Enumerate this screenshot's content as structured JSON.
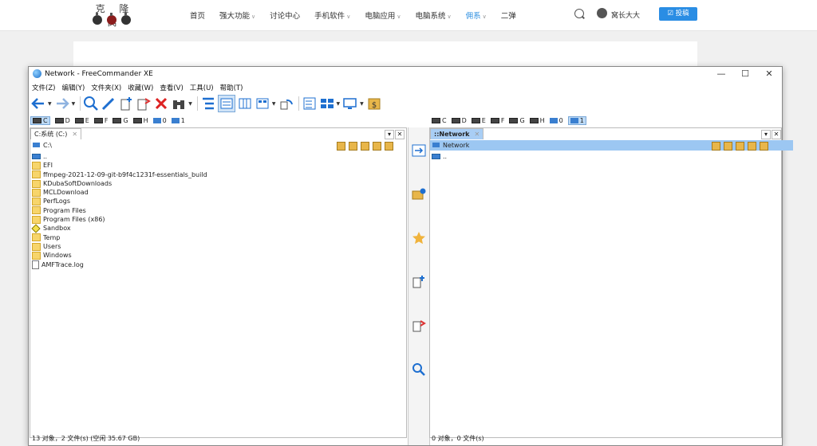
{
  "site": {
    "logo_text": "克 隆 窝",
    "nav": [
      {
        "label": "首页",
        "dropdown": false,
        "active": false
      },
      {
        "label": "强大功能",
        "dropdown": true,
        "active": false
      },
      {
        "label": "讨论中心",
        "dropdown": false,
        "active": false
      },
      {
        "label": "手机软件",
        "dropdown": true,
        "active": false
      },
      {
        "label": "电脑应用",
        "dropdown": true,
        "active": false
      },
      {
        "label": "电脑系统",
        "dropdown": true,
        "active": false
      },
      {
        "label": "佣系",
        "dropdown": true,
        "active": true
      },
      {
        "label": "二弹",
        "dropdown": false,
        "active": false
      }
    ],
    "user_name": "窝长大大",
    "submit_label": "☑ 投稿",
    "accent": "#2a8de4"
  },
  "window": {
    "title": "Network - FreeCommander XE",
    "minimize": "—",
    "maximize": "☐",
    "close": "✕"
  },
  "menu": [
    "文件(Z)",
    "编辑(Y)",
    "文件夹(X)",
    "收藏(W)",
    "查看(V)",
    "工具(U)",
    "帮助(T)"
  ],
  "drives_left": [
    {
      "label": "C",
      "selected": true
    },
    {
      "label": "D"
    },
    {
      "label": "E"
    },
    {
      "label": "F"
    },
    {
      "label": "G"
    },
    {
      "label": "H"
    }
  ],
  "drives_right": [
    {
      "label": "C"
    },
    {
      "label": "D"
    },
    {
      "label": "E"
    },
    {
      "label": "F"
    },
    {
      "label": "G"
    },
    {
      "label": "H"
    }
  ],
  "drive_extra": {
    "zero": "0",
    "one": "1"
  },
  "left_pane": {
    "tab_label": "C:系统 (C:)",
    "path": "C:\\",
    "files": [
      {
        "name": "..",
        "type": "up"
      },
      {
        "name": "EFI",
        "type": "folder"
      },
      {
        "name": "ffmpeg-2021-12-09-git-b9f4c1231f-essentials_build",
        "type": "folder"
      },
      {
        "name": "KDubaSoftDownloads",
        "type": "folder"
      },
      {
        "name": "MCLDownload",
        "type": "folder"
      },
      {
        "name": "PerfLogs",
        "type": "folder"
      },
      {
        "name": "Program Files",
        "type": "folder"
      },
      {
        "name": "Program Files (x86)",
        "type": "folder"
      },
      {
        "name": "Sandbox",
        "type": "sandbox"
      },
      {
        "name": "Temp",
        "type": "folder"
      },
      {
        "name": "Users",
        "type": "folder"
      },
      {
        "name": "Windows",
        "type": "folder"
      },
      {
        "name": "AMFTrace.log",
        "type": "file"
      }
    ],
    "status": "13 对象，2 文件(s)  (空闲 35.67 GB)"
  },
  "right_pane": {
    "tab_label": "::Network",
    "path": "Network",
    "files": [
      {
        "name": "..",
        "type": "up"
      }
    ],
    "status": "0 对象，0 文件(s)"
  }
}
